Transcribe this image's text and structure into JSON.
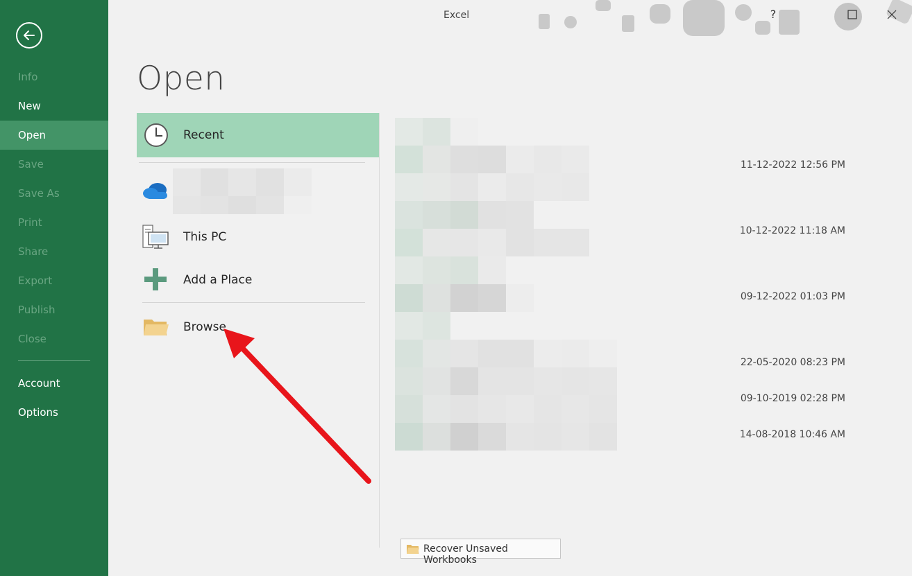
{
  "app": {
    "title": "Excel",
    "help": "?"
  },
  "sidebar": {
    "items": [
      {
        "label": "Info",
        "state": "disabled"
      },
      {
        "label": "New",
        "state": "normal"
      },
      {
        "label": "Open",
        "state": "active"
      },
      {
        "label": "Save",
        "state": "disabled"
      },
      {
        "label": "Save As",
        "state": "disabled"
      },
      {
        "label": "Print",
        "state": "disabled"
      },
      {
        "label": "Share",
        "state": "disabled"
      },
      {
        "label": "Export",
        "state": "disabled"
      },
      {
        "label": "Publish",
        "state": "disabled"
      },
      {
        "label": "Close",
        "state": "disabled"
      },
      {
        "label": "Account",
        "state": "normal"
      },
      {
        "label": "Options",
        "state": "normal"
      }
    ]
  },
  "main": {
    "title": "Open",
    "places": {
      "recent": "Recent",
      "onedrive_icon": "onedrive-icon",
      "this_pc": "This PC",
      "add_place": "Add a Place",
      "browse": "Browse"
    },
    "recent_dates": [
      "11-12-2022 12:56 PM",
      "10-12-2022 11:18 AM",
      "09-12-2022 01:03 PM",
      "22-05-2020 08:23 PM",
      "09-10-2019 02:28 PM",
      "14-08-2018 10:46 AM"
    ],
    "recover_label": "Recover Unsaved Workbooks"
  },
  "colors": {
    "sidebar": "#217346",
    "active_nav": "#439467",
    "recent_highlight": "#9fd5b7",
    "annotation_arrow": "#e8151b"
  }
}
